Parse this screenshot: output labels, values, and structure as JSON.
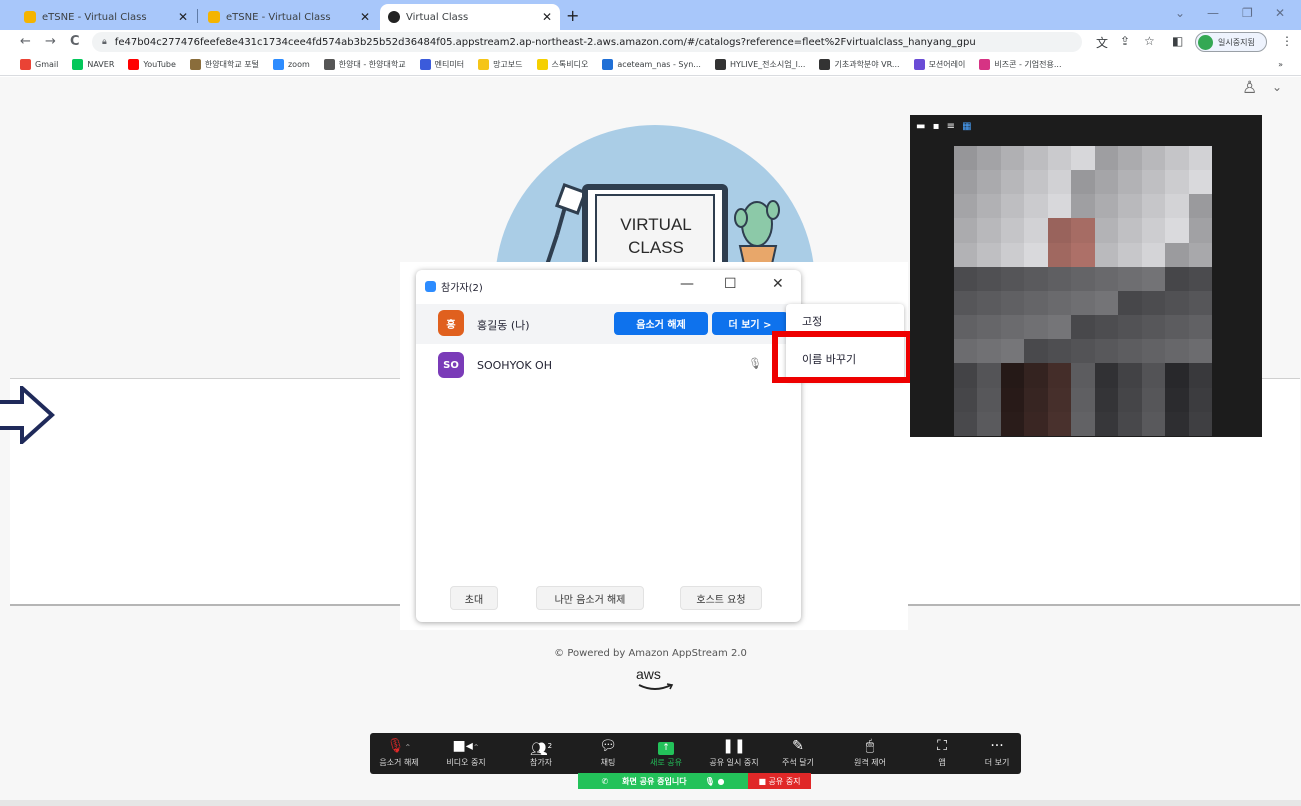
{
  "browser": {
    "tabs": [
      {
        "title": "eTSNE - Virtual Class",
        "active": false,
        "favicon_color": "#f4b400"
      },
      {
        "title": "eTSNE - Virtual Class",
        "active": false,
        "favicon_color": "#f4b400"
      },
      {
        "title": "Virtual Class",
        "active": true,
        "favicon_color": "#222222"
      }
    ],
    "new_tab": "+",
    "url": "fe47b04c277476feefe8e431c1734cee4fd574ab3b25b52d36484f05.appstream2.ap-northeast-2.aws.amazon.com/#/catalogs?reference=fleet%2Fvirtualclass_hanyang_gpu",
    "profile_label": "일시중지됨",
    "bookmarks": [
      {
        "label": "Gmail",
        "color": "#ea4335"
      },
      {
        "label": "NAVER",
        "color": "#03c75a"
      },
      {
        "label": "YouTube",
        "color": "#ff0000"
      },
      {
        "label": "한양대학교 포털",
        "color": "#8a6d3b"
      },
      {
        "label": "zoom",
        "color": "#2d8cff"
      },
      {
        "label": "한양대 - 한양대학교",
        "color": "#555555"
      },
      {
        "label": "멘티미터",
        "color": "#3b5bdb"
      },
      {
        "label": "망고보드",
        "color": "#f5c518"
      },
      {
        "label": "스톡비디오",
        "color": "#f5d000"
      },
      {
        "label": "aceteam_nas - Syn...",
        "color": "#1f6fd6"
      },
      {
        "label": "HYLIVE_전소시엄_l...",
        "color": "#333333"
      },
      {
        "label": "기초과학분야 VR...",
        "color": "#333333"
      },
      {
        "label": "모션어레이",
        "color": "#6a4cd6"
      },
      {
        "label": "비즈콘 - 기업전용...",
        "color": "#d63384"
      }
    ],
    "bookmarks_more": "»"
  },
  "hero": {
    "line1": "VIRTUAL",
    "line2": "CLASS"
  },
  "footer": {
    "powered": "© Powered by Amazon AppStream 2.0",
    "aws": "aws"
  },
  "participants_panel": {
    "title": "참가자(2)",
    "participants": [
      {
        "initial": "홍",
        "name": "홍길동 (나)",
        "avatar_color": "#e0601e"
      },
      {
        "initial": "SO",
        "name": "SOOHYOK OH",
        "avatar_color": "#7a3bb8"
      }
    ],
    "unmute_label": "음소거 해제",
    "more_label": "더 보기 >",
    "bottom_buttons": [
      "초대",
      "나만 음소거 해제",
      "호스트 요청"
    ]
  },
  "context_menu": {
    "items": [
      "고정",
      "이름 바꾸기"
    ],
    "highlighted": "이름 바꾸기",
    "highlight_color": "#ee0000"
  },
  "toolbar": {
    "items": [
      {
        "icon": "mic-off-icon",
        "label": "음소거 해제"
      },
      {
        "icon": "video-icon",
        "label": "비디오 중지"
      },
      {
        "icon": "participants-icon",
        "label": "참가자",
        "badge": "2"
      },
      {
        "icon": "chat-icon",
        "label": "채팅"
      },
      {
        "icon": "share-icon",
        "label": "새로 공유"
      },
      {
        "icon": "pause-icon",
        "label": "공유 일시 중지"
      },
      {
        "icon": "annotate-icon",
        "label": "주석 달기"
      },
      {
        "icon": "remote-control-icon",
        "label": "원격 제어"
      },
      {
        "icon": "apps-icon",
        "label": "앱"
      },
      {
        "icon": "more-icon",
        "label": "더 보기"
      }
    ],
    "sharing_status": "화면 공유 중입니다",
    "stop_share": "■ 공유 중지",
    "colors": {
      "sharing": "#23c25a",
      "stop": "#e02828"
    }
  }
}
